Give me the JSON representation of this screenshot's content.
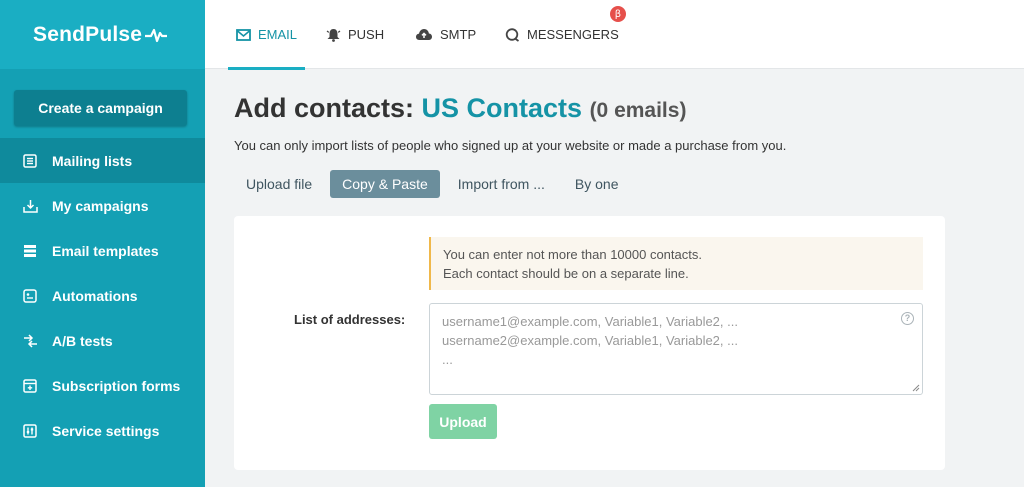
{
  "brand": {
    "logo_text": "SendPulse"
  },
  "sidebar": {
    "create_label": "Create a campaign",
    "items": [
      {
        "label": "Mailing lists",
        "icon": "list-icon"
      },
      {
        "label": "My campaigns",
        "icon": "campaigns-icon"
      },
      {
        "label": "Email templates",
        "icon": "templates-icon"
      },
      {
        "label": "Automations",
        "icon": "automations-icon"
      },
      {
        "label": "A/B tests",
        "icon": "ab-tests-icon"
      },
      {
        "label": "Subscription forms",
        "icon": "forms-icon"
      },
      {
        "label": "Service settings",
        "icon": "settings-icon"
      }
    ]
  },
  "topbar": {
    "tabs": [
      {
        "label": "EMAIL",
        "icon": "envelope-icon"
      },
      {
        "label": "PUSH",
        "icon": "bell-icon"
      },
      {
        "label": "SMTP",
        "icon": "cloud-upload-icon"
      },
      {
        "label": "MESSENGERS",
        "icon": "chat-bubble-icon"
      }
    ],
    "beta_badge": "β"
  },
  "main": {
    "title_prefix": "Add contacts: ",
    "list_name": "US Contacts",
    "count": "(0 emails)",
    "subtitle": "You can only import lists of people who signed up at your website or made a purchase from you.",
    "tabs": [
      "Upload file",
      "Copy & Paste",
      "Import from ...",
      "By one"
    ],
    "notice_line1": "You can enter not more than 10000 contacts.",
    "notice_line2": "Each contact should be on a separate line.",
    "field_label": "List of addresses:",
    "placeholder_line1": "username1@example.com, Variable1, Variable2, ...",
    "placeholder_line2": "username2@example.com, Variable1, Variable2, ...",
    "placeholder_line3": "...",
    "help_glyph": "?",
    "upload_label": "Upload"
  },
  "colors": {
    "sidebar": "#14a0b4",
    "accent": "#1593a6",
    "upload_button": "#7fd3a4",
    "beta_badge": "#e6504b"
  }
}
